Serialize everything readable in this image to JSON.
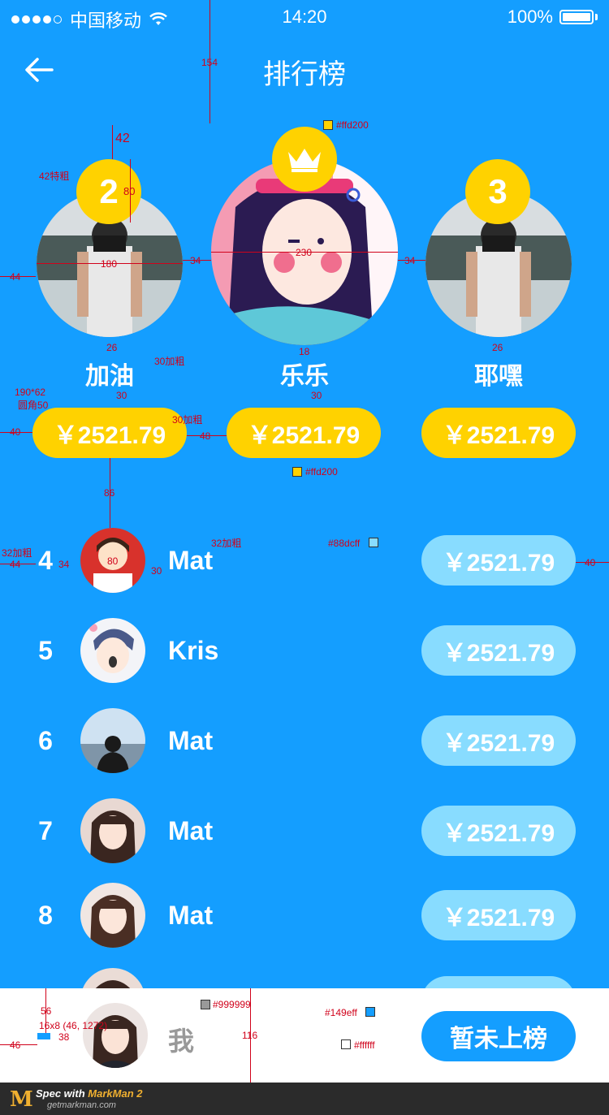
{
  "status_bar": {
    "carrier": "中国移动",
    "time": "14:20",
    "battery": "100%"
  },
  "nav": {
    "title": "排行榜"
  },
  "podium": [
    {
      "rank": "2",
      "name": "加油",
      "amount": "￥2521.79"
    },
    {
      "rank": "1",
      "name": "乐乐",
      "amount": "￥2521.79"
    },
    {
      "rank": "3",
      "name": "耶嘿",
      "amount": "￥2521.79"
    }
  ],
  "rows": [
    {
      "rank": "4",
      "name": "Mat",
      "amount": "￥2521.79"
    },
    {
      "rank": "5",
      "name": "Kris",
      "amount": "￥2521.79"
    },
    {
      "rank": "6",
      "name": "Mat",
      "amount": "￥2521.79"
    },
    {
      "rank": "7",
      "name": "Mat",
      "amount": "￥2521.79"
    },
    {
      "rank": "8",
      "name": "Mat",
      "amount": "￥2521.79"
    }
  ],
  "me": {
    "name": "我",
    "status": "暂未上榜"
  },
  "colors": {
    "background": "#149eff",
    "gold": "#ffd200",
    "light_pill": "#88dcff",
    "gray_text": "#999999",
    "white": "#ffffff"
  },
  "annotations": {
    "a154": "154",
    "a42": "42",
    "a42bold": "42特粗",
    "a80": "80",
    "a44": "44",
    "a180": "180",
    "a34a": "34",
    "a230": "230",
    "a34b": "34",
    "a26a": "26",
    "a26b": "26",
    "a30bold": "30加粗",
    "a18": "18",
    "size": "190*62",
    "radius": "圆角50",
    "a30a": "30",
    "a30b": "30",
    "a40a": "40",
    "a30bold2": "30加粗",
    "a48": "48",
    "c_ffd200a": "#ffd200",
    "c_ffd200b": "#ffd200",
    "a86": "86",
    "a32bold": "32加粗",
    "a32bold2": "32加粗",
    "a44b": "44",
    "a34c": "34",
    "a80b": "80",
    "a30c": "30",
    "c_88dcff": "#88dcff",
    "a40b": "40",
    "a56": "56",
    "icon_size": "16x8 (46, 1272)",
    "a46": "46",
    "a38": "38",
    "c_999999": "#999999",
    "a116": "116",
    "c_149eff": "#149eff",
    "c_ffffff": "#ffffff"
  },
  "footer": {
    "logo": "M",
    "spec_prefix": "Spec with ",
    "spec_brand": "MarkMan 2",
    "url": "getmarkman.com"
  }
}
